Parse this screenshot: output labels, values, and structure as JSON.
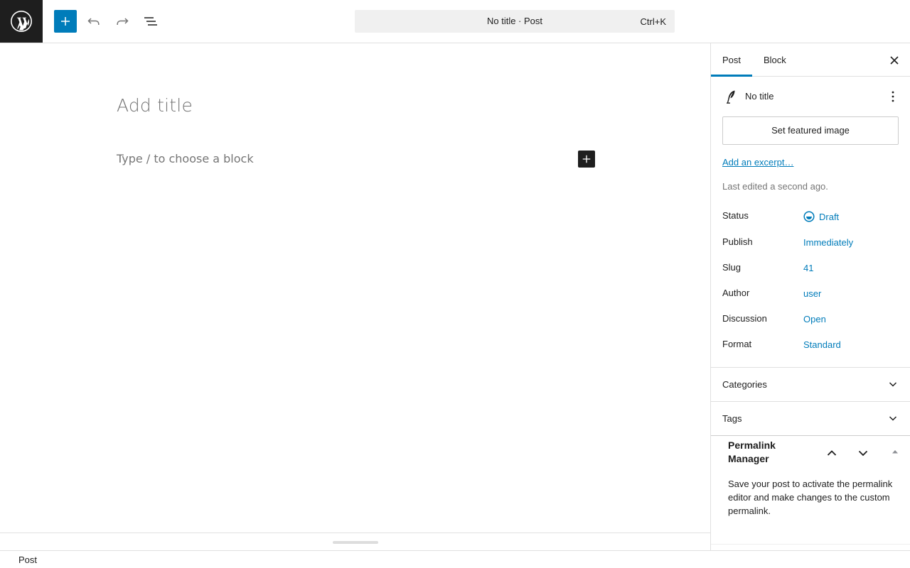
{
  "header": {
    "command_title": "No title · Post",
    "command_shortcut": "Ctrl+K"
  },
  "editor": {
    "title_placeholder": "Add title",
    "block_placeholder": "Type / to choose a block"
  },
  "sidebar": {
    "tabs": [
      {
        "label": "Post",
        "active": true
      },
      {
        "label": "Block",
        "active": false
      }
    ],
    "post_title": "No title",
    "featured_image_label": "Set featured image",
    "excerpt_link": "Add an excerpt…",
    "last_edited": "Last edited a second ago.",
    "meta": [
      {
        "label": "Status",
        "value": "Draft"
      },
      {
        "label": "Publish",
        "value": "Immediately"
      },
      {
        "label": "Slug",
        "value": "41"
      },
      {
        "label": "Author",
        "value": "user"
      },
      {
        "label": "Discussion",
        "value": "Open"
      },
      {
        "label": "Format",
        "value": "Standard"
      }
    ],
    "panels": [
      {
        "label": "Categories"
      },
      {
        "label": "Tags"
      }
    ],
    "permalink_manager": {
      "title": "Permalink Manager",
      "body": "Save your post to activate the permalink editor and make changes to the custom permalink."
    }
  },
  "footer": {
    "breadcrumb": "Post"
  },
  "colors": {
    "accent": "#007cba",
    "dark": "#1e1e1e",
    "muted": "#757575",
    "border": "#e0e0e0"
  }
}
